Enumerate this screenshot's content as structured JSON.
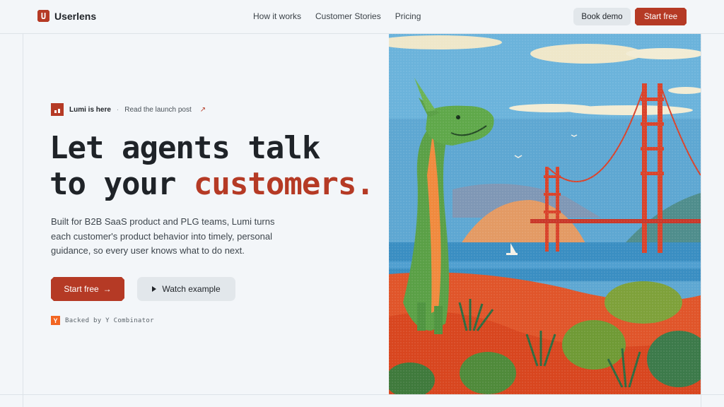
{
  "header": {
    "brand_letter": "U",
    "brand_name": "Userlens",
    "nav": [
      "How it works",
      "Customer Stories",
      "Pricing"
    ],
    "book_demo": "Book demo",
    "start_free": "Start free"
  },
  "announcement": {
    "title": "Lumi is here",
    "separator": "·",
    "link": "Read the launch post",
    "arrow": "↗"
  },
  "hero": {
    "headline_line1": "Let agents talk",
    "headline_line2_prefix": "to your ",
    "headline_accent": "customers.",
    "subtext": "Built for B2B SaaS product and PLG teams, Lumi turns each customer's product behavior into timely, personal guidance, so every user knows what to do next.",
    "cta_primary": "Start free",
    "cta_primary_arrow": "→",
    "cta_secondary": "Watch example",
    "backed_letter": "Y",
    "backed_text": "Backed by Y Combinator"
  },
  "colors": {
    "accent": "#b53a25",
    "background": "#f3f6f9",
    "yc_orange": "#f26522"
  }
}
